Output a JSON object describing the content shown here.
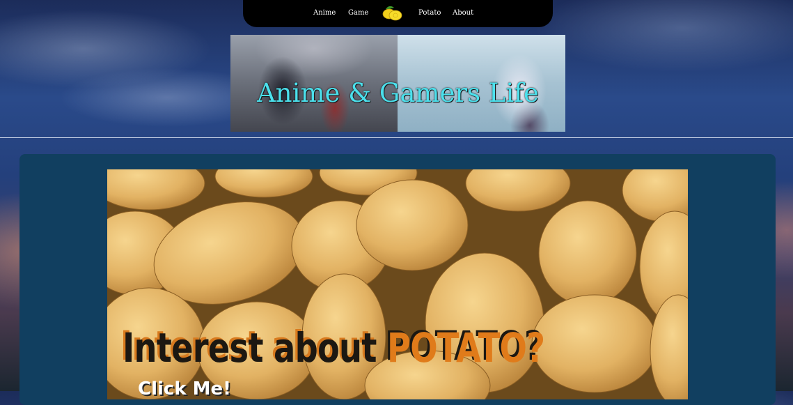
{
  "nav": {
    "items": [
      "Anime",
      "Game",
      "Potato",
      "About"
    ],
    "logo": "lemon-icon"
  },
  "banner": {
    "title": "Anime & Gamers Life"
  },
  "hero": {
    "title_part1": "Interest about ",
    "title_part2": "POTATO?",
    "link": "Click Me!"
  },
  "colors": {
    "nav_bg": "#000000",
    "panel_bg": "#113f60",
    "banner_title": "#4be0ec",
    "accent_orange": "#e07b1a"
  }
}
